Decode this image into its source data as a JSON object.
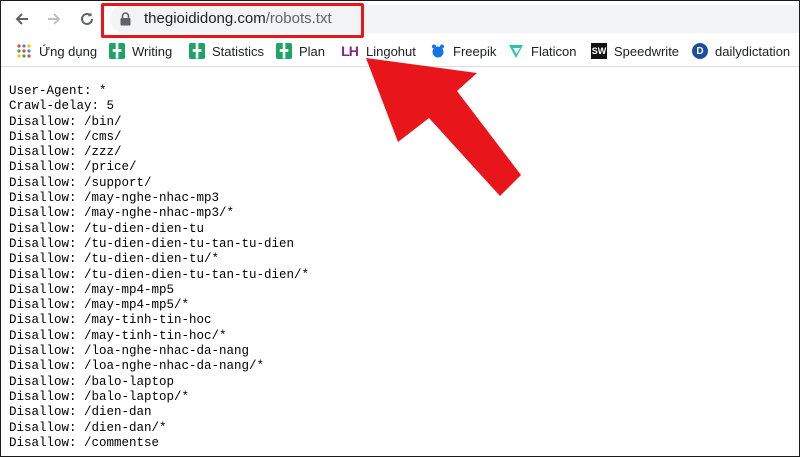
{
  "browser": {
    "url_domain": "thegioididong.com",
    "url_path": "/robots.txt",
    "back_icon": "back-arrow-icon",
    "forward_icon": "forward-arrow-icon",
    "reload_icon": "reload-icon",
    "lock_icon": "lock-icon"
  },
  "bookmarks": [
    {
      "label": "Ứng dụng",
      "icon": "apps-grid-icon"
    },
    {
      "label": "Writing",
      "icon": "google-sheets-icon"
    },
    {
      "label": "Statistics",
      "icon": "google-sheets-icon"
    },
    {
      "label": "Plan",
      "icon": "google-sheets-icon"
    },
    {
      "label": "Lingohut",
      "icon_text": "LH",
      "icon": "lingohut-icon"
    },
    {
      "label": "Freepik",
      "icon": "freepik-icon"
    },
    {
      "label": "Flaticon",
      "icon": "flaticon-icon"
    },
    {
      "label": "Speedwrite",
      "icon_text": "SW",
      "icon": "speedwrite-icon"
    },
    {
      "label": "dailydictation",
      "icon_text": "D",
      "icon": "dailydictation-icon"
    }
  ],
  "robots_lines": [
    "User-Agent: *",
    "Crawl-delay: 5",
    "Disallow: /bin/",
    "Disallow: /cms/",
    "Disallow: /zzz/",
    "Disallow: /price/",
    "Disallow: /support/",
    "Disallow: /may-nghe-nhac-mp3",
    "Disallow: /may-nghe-nhac-mp3/*",
    "Disallow: /tu-dien-dien-tu",
    "Disallow: /tu-dien-dien-tu-tan-tu-dien",
    "Disallow: /tu-dien-dien-tu/*",
    "Disallow: /tu-dien-dien-tu-tan-tu-dien/*",
    "Disallow: /may-mp4-mp5",
    "Disallow: /may-mp4-mp5/*",
    "Disallow: /may-tinh-tin-hoc",
    "Disallow: /may-tinh-tin-hoc/*",
    "Disallow: /loa-nghe-nhac-da-nang",
    "Disallow: /loa-nghe-nhac-da-nang/*",
    "Disallow: /balo-laptop",
    "Disallow: /balo-laptop/*",
    "Disallow: /dien-dan",
    "Disallow: /dien-dan/*",
    "Disallow: /commentse"
  ],
  "colors": {
    "highlight": "#e8151b",
    "arrow": "#e8151b",
    "sheets_green": "#1fa463",
    "lingohut_purple": "#7b2a8c",
    "flaticon_teal": "#2ec4a6",
    "freepik_blue": "#1273eb",
    "dailydictation_blue": "#1d4ca3"
  }
}
